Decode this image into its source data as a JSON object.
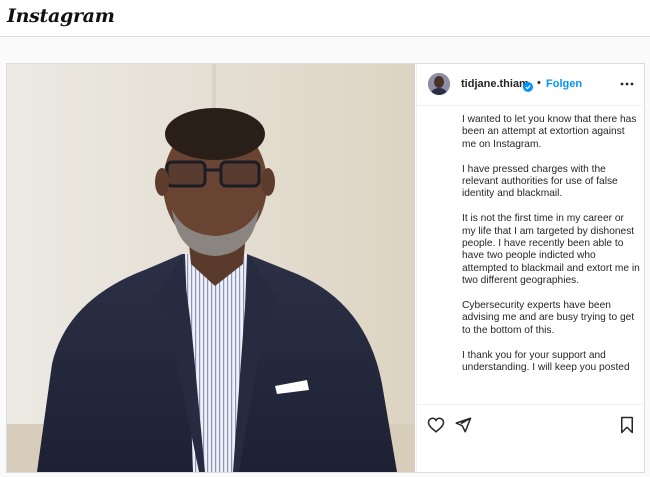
{
  "header": {
    "logo_text": "Instagram"
  },
  "post": {
    "username": "tidjane.thiam",
    "verified": true,
    "separator": "•",
    "follow_label": "Folgen",
    "more_icon": "more-horizontal-icon",
    "caption": [
      "I wanted to let you know that there has been an attempt at extortion against me on Instagram.",
      "I have pressed charges with the relevant authorities for use of false identity and blackmail.",
      "It is not the first time in my career or my life that I am targeted by dishonest people. I have recently been able to have two people indicted who attempted to blackmail and extort me in two different geographies.",
      "Cybersecurity experts have been advising me and are busy trying to get to the bottom of this.",
      "I thank you for your support and understanding. I will keep you posted"
    ],
    "actions": [
      "heart-icon",
      "share-icon",
      "bookmark-icon"
    ]
  },
  "colors": {
    "accent": "#0095f6",
    "verified": "#0095f6",
    "border": "#dbdbdb",
    "text": "#262626"
  }
}
